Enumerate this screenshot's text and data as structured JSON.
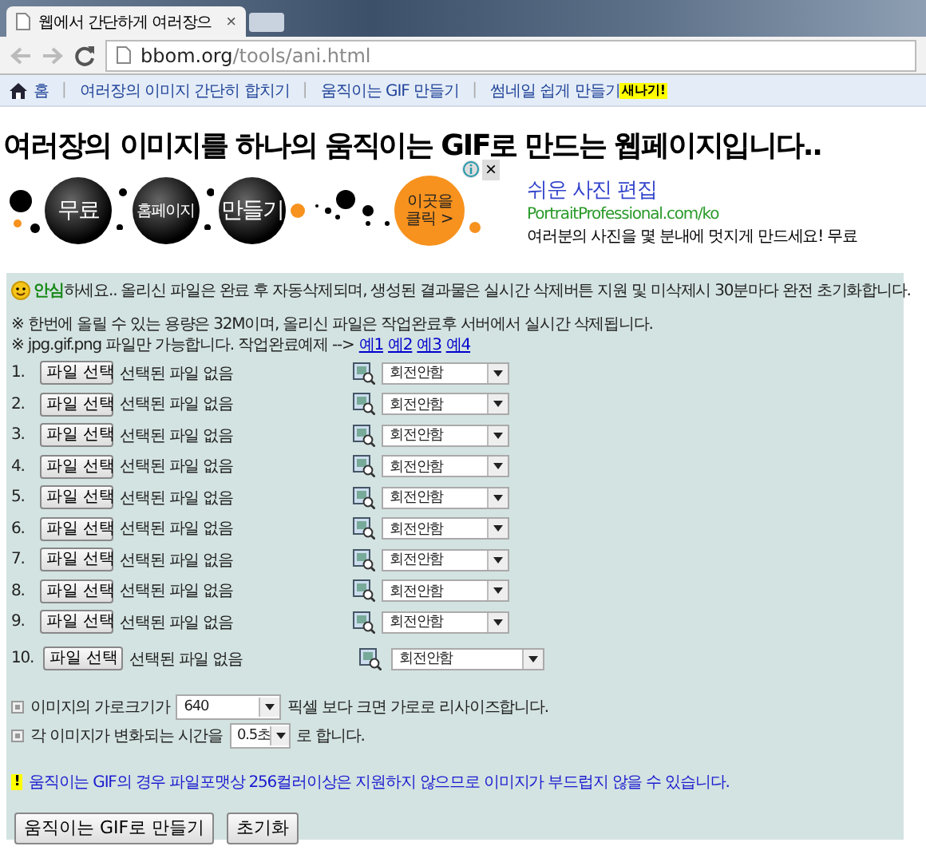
{
  "browser": {
    "tab_title": "웹에서 간단하게 여러장으",
    "tab_close": "×",
    "url_host": "bbom.org",
    "url_path": "/tools/ani.html"
  },
  "nav": {
    "home": "홈",
    "links": [
      {
        "separator": "|",
        "label": "여러장의 이미지 간단히 합치기"
      },
      {
        "separator": "|",
        "label": "움직이는 GIF 만들기"
      },
      {
        "separator": "|",
        "label": "썸네일 쉽게 만들기",
        "badge": "새나기!"
      }
    ]
  },
  "page_title": "여러장의 이미지를 하나의 움직이는 GIF로 만드는 웹페이지입니다..",
  "ad": {
    "bubbles": [
      "무료",
      "홈페이지",
      "만들기"
    ],
    "cta": "이곳을 클릭 >",
    "close": "×",
    "headline": "쉬운 사진 편집",
    "site": "PortraitProfessional.com/ko",
    "text": "여러분의 사진을 몇 분내에 멋지게 만드세요! 무료"
  },
  "panel": {
    "notice": "**안심**하세요.. 올리신 파일은 완료 후 자동삭제되며, 생성된 결과물은 실시간 삭제버튼 지원 및 미삭제시 30분마다 완전 초기화합니다.",
    "info": [
      "※ 한번에 올릴 수 있는 용량은 32M이며, 올리신 파일은 작업완료후 서버에서 실시간 삭제됩니다.",
      "※ jpg.gif.png 파일만 가능합니다. 작업완료예제 -->"
    ],
    "examples": [
      "예1",
      "예2",
      "예3",
      "예4"
    ],
    "files": [
      {
        "number": "1.",
        "button": "파일 선택",
        "status": "선택된 파일 없음",
        "rotation": "회전안함"
      },
      {
        "number": "2.",
        "button": "파일 선택",
        "status": "선택된 파일 없음",
        "rotation": "회전안함"
      },
      {
        "number": "3.",
        "button": "파일 선택",
        "status": "선택된 파일 없음",
        "rotation": "회전안함"
      },
      {
        "number": "4.",
        "button": "파일 선택",
        "status": "선택된 파일 없음",
        "rotation": "회전안함"
      },
      {
        "number": "5.",
        "button": "파일 선택",
        "status": "선택된 파일 없음",
        "rotation": "회전안함"
      },
      {
        "number": "6.",
        "button": "파일 선택",
        "status": "선택된 파일 없음",
        "rotation": "회전안함"
      },
      {
        "number": "7.",
        "button": "파일 선택",
        "status": "선택된 파일 없음",
        "rotation": "회전안함"
      },
      {
        "number": "8.",
        "button": "파일 선택",
        "status": "선택된 파일 없음",
        "rotation": "회전안함"
      },
      {
        "number": "9.",
        "button": "파일 선택",
        "status": "선택된 파일 없음",
        "rotation": "회전안함"
      },
      {
        "number": "10.",
        "button": "파일 선택",
        "status": "선택된 파일 없음",
        "rotation": "회전안함"
      }
    ],
    "width_setting": {
      "before": "이미지의 가로크기가",
      "value": "640",
      "after": "픽셀 보다 크면 가로로 리사이즈합니다."
    },
    "delay_setting": {
      "before": "각 이미지가 변화되는 시간을",
      "value": "0.5초",
      "after": "로 합니다."
    },
    "warning": {
      "mark": "!",
      "text": "움직이는 GIF의 경우 파일포맷상 256컬러이상은 지원하지 않으므로 이미지가 부드럽지 않을 수 있습니다."
    },
    "buttons": [
      "움직이는 GIF로 만들기",
      "초기화"
    ]
  }
}
